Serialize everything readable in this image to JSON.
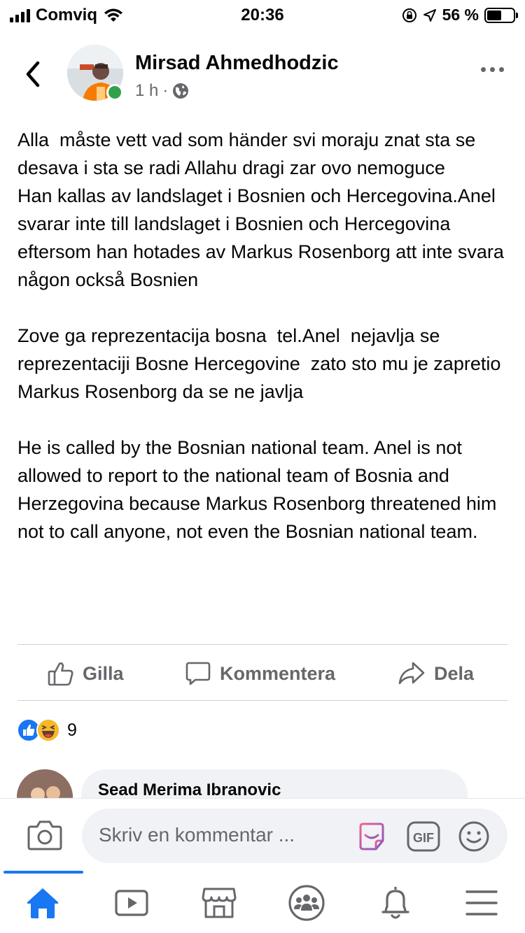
{
  "status_bar": {
    "carrier": "Comviq",
    "time": "20:36",
    "battery_percent": "56 %",
    "battery_level": 0.56
  },
  "post": {
    "author_name": "Mirsad Ahmedhodzic",
    "time_ago": "1 h",
    "separator": "·",
    "audience_icon": "globe-icon",
    "paragraphs": [
      "Alla  måste vett vad som händer svi moraju znat sta se desava i sta se radi Allahu dragi zar ovo nemoguce\nHan kallas av landslaget i Bosnien och Hercegovina.Anel svarar inte till landslaget i Bosnien och Hercegovina eftersom han hotades av Markus Rosenborg att inte svara någon också Bosnien",
      "Zove ga reprezentacija bosna  tel.Anel  nejavlja se reprezentaciji Bosne Hercegovine  zato sto mu je zapretio Markus Rosenborg da se ne javlja",
      "He is called by the Bosnian national team. Anel is not allowed to report to the national team of Bosnia and Herzegovina because Markus Rosenborg threatened him not to call anyone, not even the Bosnian national team."
    ]
  },
  "actions": {
    "like_label": "Gilla",
    "comment_label": "Kommentera",
    "share_label": "Dela"
  },
  "reactions": {
    "types": [
      "like",
      "haha"
    ],
    "count": "9"
  },
  "comments": [
    {
      "author": "Sead Merima Ibranovic"
    }
  ],
  "composer": {
    "placeholder": "Skriv en kommentar ..."
  },
  "tab_bar": {
    "items": [
      "home-icon",
      "watch-icon",
      "marketplace-icon",
      "groups-icon",
      "notifications-icon",
      "menu-icon"
    ],
    "active": "home-icon"
  },
  "colors": {
    "accent": "#1877f2",
    "online": "#31a24c",
    "muted_text": "#65676b",
    "bubble_bg": "#f0f2f5"
  }
}
